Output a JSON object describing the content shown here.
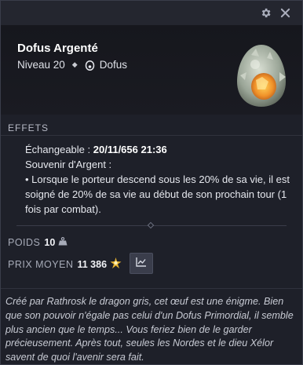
{
  "item": {
    "name": "Dofus Argenté",
    "level": "Niveau 20",
    "type": "Dofus"
  },
  "sections": {
    "effets": "EFFETS",
    "poids": "POIDS",
    "prix_moyen": "PRIX MOYEN"
  },
  "effects": {
    "exchangeable_label": "Échangeable :",
    "exchangeable_date": "20/11/656 21:36",
    "souvenir_title": "Souvenir d'Argent :",
    "souvenir_desc": "• Lorsque le porteur descend sous les 20% de sa vie, il est soigné de 20% de sa vie au début de son prochain tour (1 fois par combat)."
  },
  "stats": {
    "poids": "10",
    "prix": "11 386"
  },
  "description": "Créé par Rathrosk le dragon gris, cet œuf est une énigme. Bien que son pouvoir n'égale pas celui d'un Dofus Primordial, il semble plus ancien que le temps... Vous feriez bien de le garder précieusement. Après tout, seules les Nordes et le dieu Xélor savent de quoi l'avenir sera fait.",
  "icons": {
    "settings": "gear-icon",
    "close": "close-icon",
    "type": "dofus-egg-icon",
    "weight": "weight-icon",
    "currency": "kama-icon",
    "price_chart": "chart-icon"
  },
  "colors": {
    "background": "#1e2029",
    "header": "#16171d",
    "kama": "#e8b431"
  }
}
